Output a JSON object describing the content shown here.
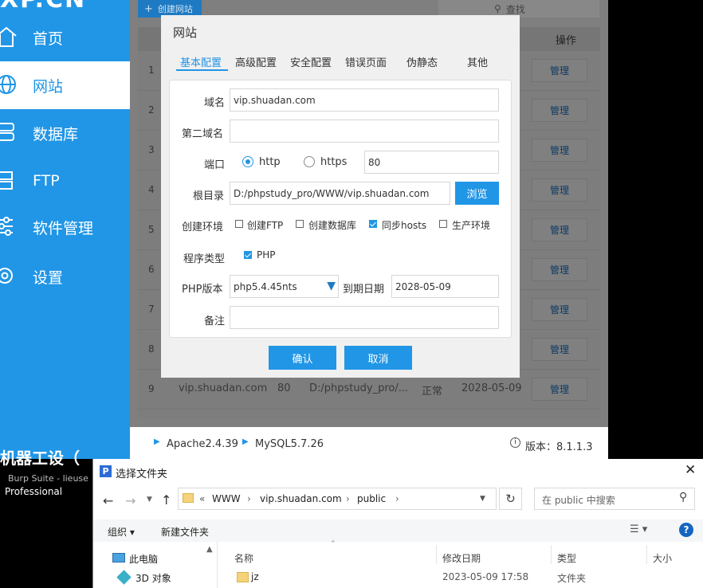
{
  "app": {
    "logo_text": "XP.CN"
  },
  "sidebar": {
    "items": [
      {
        "label": "首页",
        "icon": "home-icon"
      },
      {
        "label": "网站",
        "icon": "globe-icon"
      },
      {
        "label": "数据库",
        "icon": "database-icon"
      },
      {
        "label": "FTP",
        "icon": "server-icon"
      },
      {
        "label": "软件管理",
        "icon": "sliders-icon"
      },
      {
        "label": "设置",
        "icon": "gear-icon"
      }
    ],
    "active_index": 1,
    "color": "#2196e6"
  },
  "main": {
    "create_label": "创建网站",
    "search_placeholder": "查找",
    "op_header": "操作",
    "manage_label": "管理",
    "rows": [
      "1",
      "2",
      "3",
      "4",
      "5",
      "6",
      "7",
      "8",
      "9"
    ],
    "row9": {
      "domain": "vip.shuadan.com",
      "port": "80",
      "path": "D:/phpstudy_pro/...",
      "status": "正常",
      "expiry": "2028-05-09"
    }
  },
  "statusbar": {
    "apache": "Apache2.4.39",
    "mysql": "MySQL5.7.26",
    "version": "版本：8.1.1.3"
  },
  "modal": {
    "title": "网站",
    "tabs": [
      "基本配置",
      "高级配置",
      "安全配置",
      "错误页面",
      "伪静态",
      "其他"
    ],
    "active_tab": 0,
    "form": {
      "domain_label": "域名",
      "domain_value": "vip.shuadan.com",
      "second_domain_label": "第二域名",
      "second_domain_value": "",
      "port_label": "端口",
      "http_label": "http",
      "https_label": "https",
      "port_value": "80",
      "root_label": "根目录",
      "root_value": "D:/phpstudy_pro/WWW/vip.shuadan.com",
      "browse_label": "浏览",
      "env_label": "创建环境",
      "env_options": [
        "创建FTP",
        "创建数据库",
        "同步hosts",
        "生产环境"
      ],
      "env_checked": [
        false,
        false,
        true,
        false
      ],
      "program_label": "程序类型",
      "program_option": "PHP",
      "program_checked": true,
      "php_label": "PHP版本",
      "php_value": "php5.4.45nts",
      "expiry_label": "到期日期",
      "expiry_value": "2028-05-09",
      "note_label": "备注",
      "note_value": ""
    },
    "confirm_label": "确认",
    "cancel_label": "取消"
  },
  "background_text": {
    "line1": "机器工设（",
    "line2": "Burp Suite - lieuse",
    "line3": "Professional"
  },
  "file_dialog": {
    "title": "选择文件夹",
    "path": [
      "WWW",
      "vip.shuadan.com",
      "public"
    ],
    "path_prefix": "«",
    "search_placeholder": "在 public 中搜索",
    "organize_label": "组织 ▾",
    "new_folder_label": "新建文件夹",
    "tree": [
      {
        "label": "此电脑",
        "icon": "computer-icon"
      },
      {
        "label": "3D 对象",
        "icon": "cube-icon"
      }
    ],
    "columns": [
      "名称",
      "修改日期",
      "类型",
      "大小"
    ],
    "files": [
      {
        "name": "jz",
        "modified": "2023-05-09 17:58",
        "type": "文件夹"
      }
    ]
  }
}
